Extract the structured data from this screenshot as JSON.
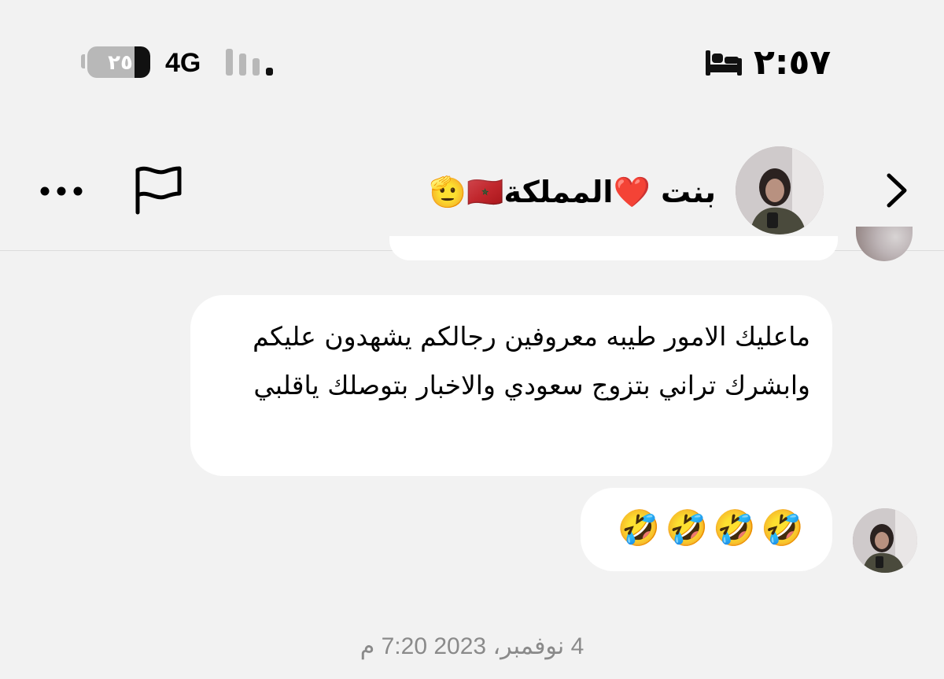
{
  "status_bar": {
    "time": "٢:٥٧",
    "network": "4G",
    "battery_level": "٢٥",
    "battery_fraction": 0.25,
    "signal_bars_active": 1,
    "signal_bars_total": 4,
    "focus_icon": "bed-icon"
  },
  "header": {
    "contact_name": "بنت ❤️المملكة🇲🇦🫡",
    "back_icon": "chevron-right-icon",
    "report_icon": "flag-icon",
    "more_icon": "more-horizontal-icon"
  },
  "messages": [
    {
      "text": "ماعليك الامور طيبه معروفين رجالكم يشهدون عليكم وابشرك تراني بتزوج سعودي والاخبار بتوصلك ياقلبي"
    },
    {
      "text": "🤣🤣🤣🤣"
    }
  ],
  "timestamp": "4 نوفمبر، 2023 7:20 م",
  "colors": {
    "background": "#f2f2f2",
    "bubble": "#ffffff",
    "timestamp": "#8a8a8a",
    "battery_empty": "#b8b8b8",
    "battery_fill": "#111111",
    "signal_inactive": "#b8b8b8",
    "signal_active": "#111111"
  }
}
